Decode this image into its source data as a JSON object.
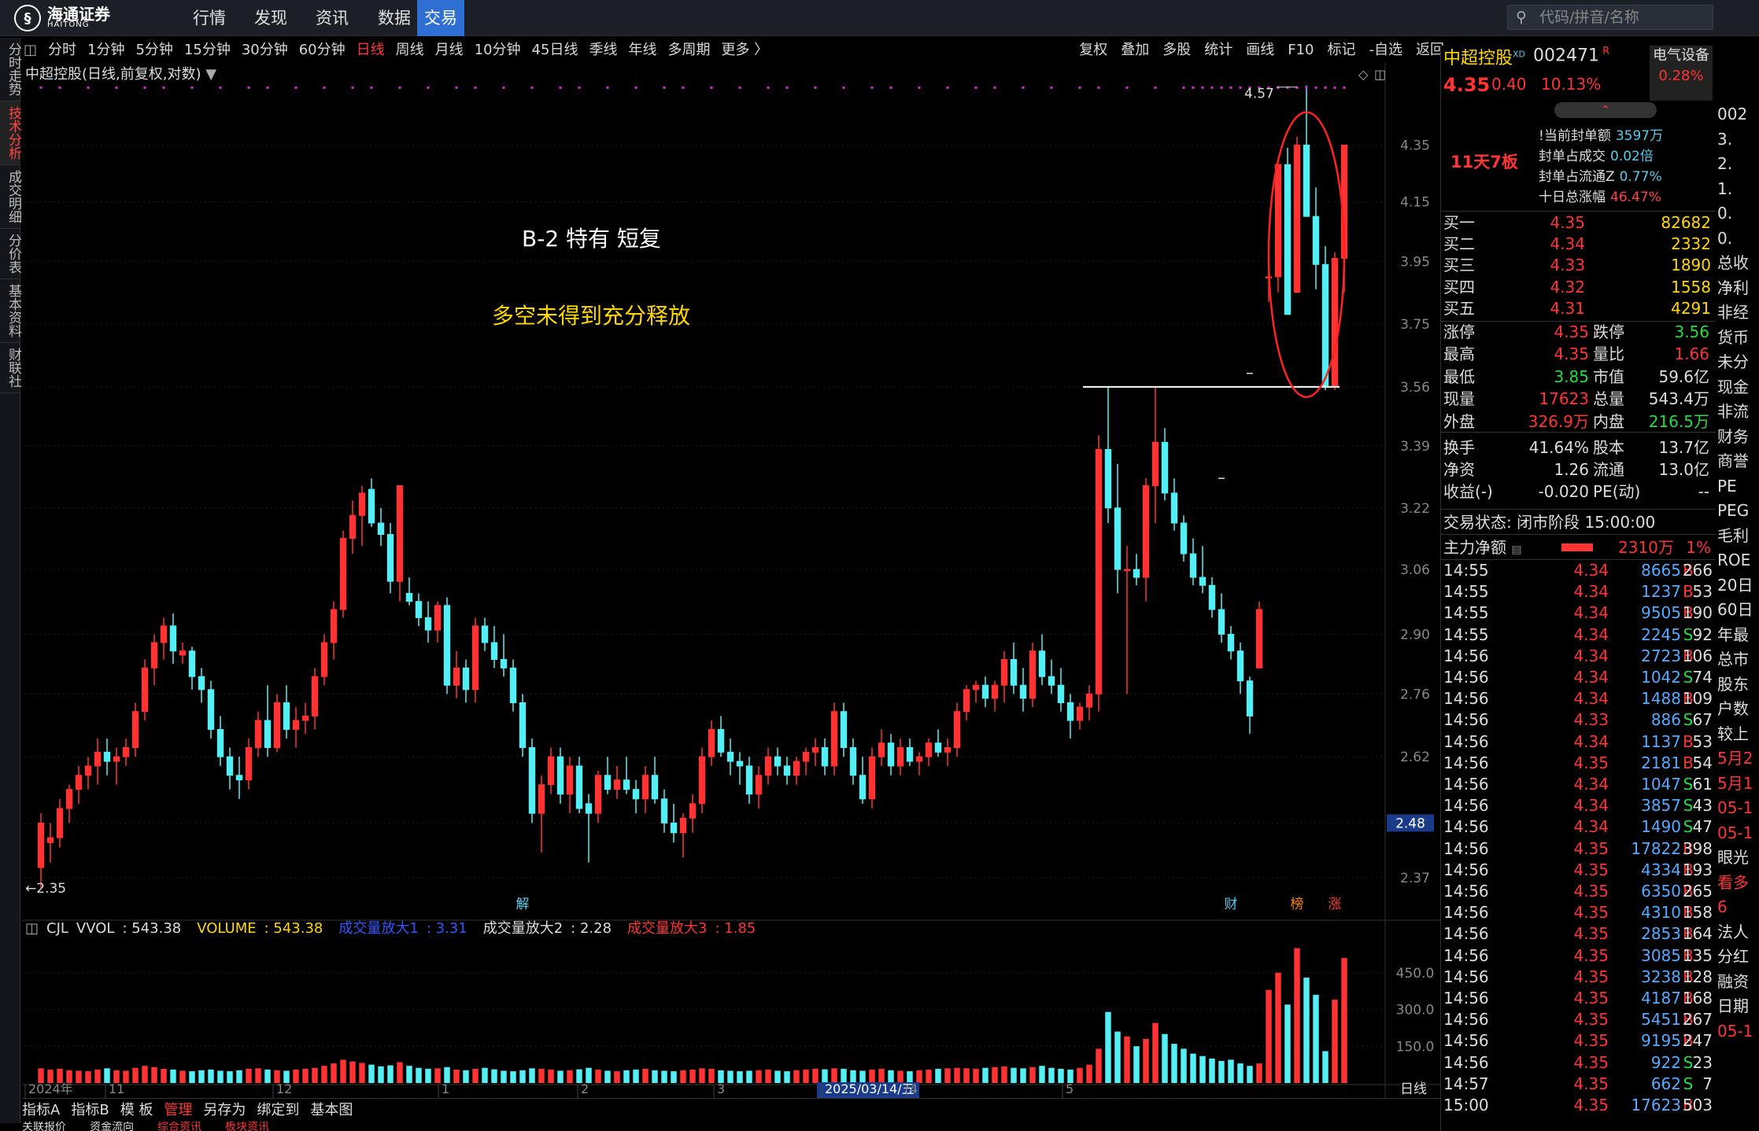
{
  "app": {
    "logo_text": "海通证券",
    "logo_sub": "HAITONG",
    "nav": [
      "行情",
      "发现",
      "资讯",
      "数据",
      "交易"
    ],
    "nav_active": "交易",
    "search_placeholder": "代码/拼音/名称"
  },
  "periods": [
    "分时",
    "1分钟",
    "5分钟",
    "15分钟",
    "30分钟",
    "60分钟",
    "日线",
    "周线",
    "月线",
    "10分钟",
    "45日线",
    "季线",
    "年线",
    "多周期",
    "更多 〉"
  ],
  "period_active": "日线",
  "tools_right": [
    "复权",
    "叠加",
    "多股",
    "统计",
    "画线",
    "F10",
    "标记",
    "-自选",
    "返回"
  ],
  "side_tabs": [
    "分时走势",
    "技术分析",
    "成交明细",
    "分价表",
    "基本资料",
    "财联社"
  ],
  "side_active": "技术分析",
  "chart_title": "中超控股(日线,前复权,对数)",
  "annotations": {
    "line1": "B-2 特有  短复",
    "line2": "多空未得到充分释放"
  },
  "chart_data": {
    "type": "candlestick",
    "price_axis": [
      4.35,
      4.15,
      3.95,
      3.75,
      3.56,
      3.39,
      3.22,
      3.06,
      2.9,
      2.76,
      2.62,
      2.48,
      2.37
    ],
    "price_range": [
      2.3,
      4.62
    ],
    "current_label": "2.48",
    "high_mark": "4.57",
    "low_mark": "←2.35",
    "event_marks": [
      "解",
      "财",
      "榜",
      "涨"
    ],
    "x_labels": [
      "2024年",
      "11",
      "12",
      "1",
      "2",
      "3",
      "2025/03/14/五",
      "4",
      "5"
    ],
    "period_label": "日线",
    "ohlc": [
      [
        2.39,
        2.5,
        2.35,
        2.48
      ],
      [
        2.44,
        2.48,
        2.4,
        2.45
      ],
      [
        2.45,
        2.53,
        2.43,
        2.51
      ],
      [
        2.51,
        2.56,
        2.48,
        2.55
      ],
      [
        2.55,
        2.6,
        2.52,
        2.58
      ],
      [
        2.58,
        2.62,
        2.55,
        2.6
      ],
      [
        2.6,
        2.66,
        2.56,
        2.63
      ],
      [
        2.63,
        2.66,
        2.58,
        2.61
      ],
      [
        2.61,
        2.64,
        2.56,
        2.62
      ],
      [
        2.62,
        2.66,
        2.6,
        2.64
      ],
      [
        2.64,
        2.74,
        2.62,
        2.72
      ],
      [
        2.72,
        2.84,
        2.7,
        2.82
      ],
      [
        2.82,
        2.9,
        2.78,
        2.88
      ],
      [
        2.88,
        2.94,
        2.84,
        2.92
      ],
      [
        2.92,
        2.95,
        2.83,
        2.86
      ],
      [
        2.85,
        2.88,
        2.83,
        2.86
      ],
      [
        2.86,
        2.87,
        2.77,
        2.8
      ],
      [
        2.8,
        2.82,
        2.74,
        2.77
      ],
      [
        2.77,
        2.79,
        2.66,
        2.68
      ],
      [
        2.68,
        2.71,
        2.6,
        2.62
      ],
      [
        2.62,
        2.64,
        2.55,
        2.58
      ],
      [
        2.58,
        2.62,
        2.53,
        2.57
      ],
      [
        2.57,
        2.66,
        2.55,
        2.64
      ],
      [
        2.64,
        2.72,
        2.62,
        2.7
      ],
      [
        2.7,
        2.78,
        2.62,
        2.64
      ],
      [
        2.64,
        2.76,
        2.63,
        2.74
      ],
      [
        2.74,
        2.78,
        2.66,
        2.68
      ],
      [
        2.68,
        2.73,
        2.64,
        2.7
      ],
      [
        2.7,
        2.74,
        2.67,
        2.71
      ],
      [
        2.71,
        2.82,
        2.68,
        2.8
      ],
      [
        2.8,
        2.9,
        2.78,
        2.88
      ],
      [
        2.88,
        2.98,
        2.84,
        2.96
      ],
      [
        2.96,
        3.16,
        2.94,
        3.14
      ],
      [
        3.14,
        3.24,
        3.1,
        3.2
      ],
      [
        3.2,
        3.28,
        3.12,
        3.26
      ],
      [
        3.27,
        3.3,
        3.17,
        3.18
      ],
      [
        3.18,
        3.22,
        3.12,
        3.15
      ],
      [
        3.15,
        3.18,
        3.0,
        3.03
      ],
      [
        3.03,
        3.28,
        2.98,
        3.28
      ],
      [
        3.0,
        3.04,
        2.97,
        2.98
      ],
      [
        2.98,
        3.0,
        2.92,
        2.94
      ],
      [
        2.94,
        2.98,
        2.88,
        2.91
      ],
      [
        2.91,
        2.98,
        2.88,
        2.97
      ],
      [
        2.97,
        2.99,
        2.76,
        2.78
      ],
      [
        2.78,
        2.86,
        2.75,
        2.82
      ],
      [
        2.82,
        2.84,
        2.74,
        2.77
      ],
      [
        2.77,
        2.94,
        2.74,
        2.92
      ],
      [
        2.92,
        2.94,
        2.86,
        2.88
      ],
      [
        2.88,
        2.92,
        2.82,
        2.84
      ],
      [
        2.84,
        2.9,
        2.8,
        2.82
      ],
      [
        2.82,
        2.84,
        2.72,
        2.74
      ],
      [
        2.74,
        2.76,
        2.62,
        2.64
      ],
      [
        2.64,
        2.66,
        2.48,
        2.5
      ],
      [
        2.5,
        2.58,
        2.42,
        2.56
      ],
      [
        2.56,
        2.64,
        2.54,
        2.62
      ],
      [
        2.62,
        2.64,
        2.52,
        2.54
      ],
      [
        2.54,
        2.62,
        2.5,
        2.6
      ],
      [
        2.6,
        2.62,
        2.5,
        2.51
      ],
      [
        2.52,
        2.54,
        2.4,
        2.5
      ],
      [
        2.5,
        2.59,
        2.48,
        2.58
      ],
      [
        2.58,
        2.62,
        2.54,
        2.55
      ],
      [
        2.55,
        2.6,
        2.53,
        2.57
      ],
      [
        2.57,
        2.62,
        2.54,
        2.55
      ],
      [
        2.55,
        2.57,
        2.5,
        2.53
      ],
      [
        2.53,
        2.6,
        2.5,
        2.58
      ],
      [
        2.58,
        2.62,
        2.52,
        2.53
      ],
      [
        2.53,
        2.55,
        2.46,
        2.48
      ],
      [
        2.48,
        2.52,
        2.44,
        2.46
      ],
      [
        2.46,
        2.5,
        2.41,
        2.49
      ],
      [
        2.49,
        2.54,
        2.46,
        2.52
      ],
      [
        2.52,
        2.64,
        2.5,
        2.62
      ],
      [
        2.62,
        2.7,
        2.6,
        2.68
      ],
      [
        2.68,
        2.71,
        2.62,
        2.63
      ],
      [
        2.63,
        2.66,
        2.58,
        2.61
      ],
      [
        2.61,
        2.63,
        2.56,
        2.6
      ],
      [
        2.6,
        2.62,
        2.52,
        2.54
      ],
      [
        2.54,
        2.6,
        2.51,
        2.58
      ],
      [
        2.58,
        2.64,
        2.56,
        2.62
      ],
      [
        2.62,
        2.64,
        2.58,
        2.6
      ],
      [
        2.6,
        2.62,
        2.56,
        2.58
      ],
      [
        2.58,
        2.62,
        2.56,
        2.61
      ],
      [
        2.61,
        2.64,
        2.58,
        2.63
      ],
      [
        2.63,
        2.66,
        2.6,
        2.64
      ],
      [
        2.64,
        2.66,
        2.58,
        2.6
      ],
      [
        2.6,
        2.74,
        2.58,
        2.72
      ],
      [
        2.72,
        2.74,
        2.62,
        2.64
      ],
      [
        2.64,
        2.66,
        2.56,
        2.58
      ],
      [
        2.58,
        2.62,
        2.52,
        2.53
      ],
      [
        2.53,
        2.64,
        2.51,
        2.62
      ],
      [
        2.62,
        2.68,
        2.6,
        2.65
      ],
      [
        2.65,
        2.67,
        2.58,
        2.6
      ],
      [
        2.6,
        2.66,
        2.58,
        2.64
      ],
      [
        2.64,
        2.66,
        2.6,
        2.61
      ],
      [
        2.61,
        2.63,
        2.58,
        2.62
      ],
      [
        2.62,
        2.66,
        2.6,
        2.65
      ],
      [
        2.65,
        2.68,
        2.62,
        2.63
      ],
      [
        2.63,
        2.66,
        2.6,
        2.64
      ],
      [
        2.64,
        2.74,
        2.62,
        2.72
      ],
      [
        2.72,
        2.78,
        2.7,
        2.77
      ],
      [
        2.77,
        2.79,
        2.74,
        2.78
      ],
      [
        2.78,
        2.8,
        2.73,
        2.75
      ],
      [
        2.75,
        2.79,
        2.72,
        2.78
      ],
      [
        2.78,
        2.86,
        2.74,
        2.84
      ],
      [
        2.84,
        2.88,
        2.76,
        2.78
      ],
      [
        2.78,
        2.82,
        2.72,
        2.75
      ],
      [
        2.75,
        2.88,
        2.73,
        2.86
      ],
      [
        2.86,
        2.9,
        2.78,
        2.8
      ],
      [
        2.8,
        2.84,
        2.76,
        2.78
      ],
      [
        2.78,
        2.82,
        2.72,
        2.74
      ],
      [
        2.74,
        2.76,
        2.66,
        2.7
      ],
      [
        2.7,
        2.74,
        2.68,
        2.73
      ],
      [
        2.73,
        2.78,
        2.7,
        2.76
      ],
      [
        2.76,
        3.42,
        2.72,
        3.38
      ],
      [
        3.38,
        3.56,
        3.18,
        3.22
      ],
      [
        3.22,
        3.34,
        3.0,
        3.06
      ],
      [
        3.06,
        3.12,
        2.76,
        3.06
      ],
      [
        3.06,
        3.1,
        3.02,
        3.04
      ],
      [
        3.04,
        3.3,
        2.98,
        3.28
      ],
      [
        3.28,
        3.56,
        3.18,
        3.4
      ],
      [
        3.4,
        3.44,
        3.24,
        3.26
      ],
      [
        3.26,
        3.3,
        3.16,
        3.18
      ],
      [
        3.18,
        3.2,
        3.08,
        3.1
      ],
      [
        3.1,
        3.14,
        3.02,
        3.04
      ],
      [
        3.04,
        3.12,
        3.0,
        3.02
      ],
      [
        3.02,
        3.04,
        2.94,
        2.96
      ],
      [
        2.96,
        3.0,
        2.88,
        2.9
      ],
      [
        2.9,
        2.92,
        2.84,
        2.86
      ],
      [
        2.86,
        2.88,
        2.76,
        2.79
      ],
      [
        2.79,
        2.8,
        2.67,
        2.71
      ],
      [
        2.82,
        2.98,
        2.82,
        2.96
      ],
      [
        3.9,
        3.94,
        3.82,
        3.9
      ],
      [
        3.9,
        4.28,
        3.85,
        4.28
      ],
      [
        4.28,
        4.34,
        3.78,
        3.78
      ],
      [
        3.85,
        4.38,
        3.85,
        4.35
      ],
      [
        4.35,
        4.57,
        4.1,
        4.1
      ],
      [
        4.1,
        4.2,
        3.86,
        3.94
      ],
      [
        3.94,
        4.0,
        3.55,
        3.56
      ],
      [
        3.56,
        3.98,
        3.55,
        3.96
      ],
      [
        3.96,
        4.35,
        3.85,
        4.35
      ]
    ],
    "volume": [
      60,
      55,
      58,
      52,
      50,
      48,
      55,
      60,
      52,
      50,
      62,
      70,
      65,
      58,
      55,
      50,
      48,
      52,
      55,
      50,
      48,
      52,
      58,
      60,
      55,
      52,
      50,
      55,
      58,
      62,
      70,
      80,
      95,
      88,
      82,
      75,
      68,
      72,
      85,
      70,
      62,
      58,
      60,
      65,
      55,
      52,
      58,
      62,
      56,
      50,
      48,
      52,
      60,
      58,
      55,
      50,
      52,
      56,
      62,
      55,
      50,
      48,
      52,
      55,
      58,
      52,
      50,
      48,
      52,
      55,
      60,
      58,
      52,
      50,
      48,
      50,
      52,
      55,
      50,
      48,
      52,
      55,
      58,
      56,
      60,
      58,
      52,
      50,
      55,
      58,
      52,
      50,
      48,
      52,
      55,
      58,
      60,
      62,
      60,
      58,
      62,
      65,
      68,
      62,
      60,
      65,
      70,
      62,
      58,
      55,
      62,
      75,
      140,
      290,
      210,
      190,
      150,
      180,
      245,
      200,
      160,
      140,
      120,
      110,
      100,
      90,
      95,
      80,
      70,
      80,
      380,
      450,
      320,
      550,
      430,
      360,
      130,
      340,
      510
    ],
    "vol_axis": [
      450.0,
      300.0,
      150.0
    ],
    "vol_range": [
      0,
      600
    ],
    "indicator_name": "CJL",
    "indicator_values": [
      {
        "name": "VVOL",
        "value": "543.38",
        "color": "#dddddd"
      },
      {
        "name": "VOLUME",
        "value": "543.38",
        "color": "#ffd700"
      },
      {
        "name": "成交量放大1",
        "value": "3.31",
        "color": "#3355ff"
      },
      {
        "name": "成交量放大2",
        "value": "2.28",
        "color": "#dddddd"
      },
      {
        "name": "成交量放大3",
        "value": "1.85",
        "color": "#ff3333"
      }
    ]
  },
  "quote": {
    "name": "中超控股",
    "tag": "XD",
    "code": "002471",
    "r_flag": "R",
    "price": "4.35",
    "change": "0.40",
    "pct": "10.13%",
    "sector": "电气设备",
    "sector_pct": "0.28%",
    "seal_label": "11天7板",
    "seal": [
      {
        "k": "!当前封单额",
        "v": "3597万"
      },
      {
        "k": "封单占成交",
        "v": "0.02倍"
      },
      {
        "k": "封单占流通Z",
        "v": "0.77%"
      },
      {
        "k": "十日总涨幅",
        "v": "46.47%"
      }
    ],
    "bids": [
      {
        "l": "买一",
        "p": "4.35",
        "v": "82682"
      },
      {
        "l": "买二",
        "p": "4.34",
        "v": "2332"
      },
      {
        "l": "买三",
        "p": "4.33",
        "v": "1890"
      },
      {
        "l": "买四",
        "p": "4.32",
        "v": "1558"
      },
      {
        "l": "买五",
        "p": "4.31",
        "v": "4291"
      }
    ],
    "stats": [
      {
        "l1": "涨停",
        "v1": "4.35",
        "c1": "red",
        "l2": "跌停",
        "v2": "3.56",
        "c2": "green"
      },
      {
        "l1": "最高",
        "v1": "4.35",
        "c1": "red",
        "l2": "量比",
        "v2": "1.66",
        "c2": "red"
      },
      {
        "l1": "最低",
        "v1": "3.85",
        "c1": "green",
        "l2": "市值",
        "v2": "59.6亿",
        "c2": "white"
      },
      {
        "l1": "现量",
        "v1": "17623",
        "c1": "red",
        "l2": "总量",
        "v2": "543.4万",
        "c2": "white"
      },
      {
        "l1": "外盘",
        "v1": "326.9万",
        "c1": "red",
        "l2": "内盘",
        "v2": "216.5万",
        "c2": "green"
      },
      {
        "l1": "换手",
        "v1": "41.64%",
        "c1": "white",
        "l2": "股本",
        "v2": "13.7亿",
        "c2": "white"
      },
      {
        "l1": "净资",
        "v1": "1.26",
        "c1": "white",
        "l2": "流通",
        "v2": "13.0亿",
        "c2": "white"
      },
      {
        "l1": "收益(-)",
        "v1": "-0.020",
        "c1": "white",
        "l2": "PE(动)",
        "v2": "--",
        "c2": "white"
      }
    ],
    "trade_status": "交易状态: 闭市阶段 15:00:00",
    "main_flow_label": "主力净额",
    "main_flow_value": "2310万",
    "main_flow_pct": "1%"
  },
  "ticks": [
    {
      "t": "14:55",
      "p": "4.34",
      "v": "8665",
      "bs": "B",
      "n": "266"
    },
    {
      "t": "14:55",
      "p": "4.34",
      "v": "1237",
      "bs": "B",
      "n": "53"
    },
    {
      "t": "14:55",
      "p": "4.34",
      "v": "9505",
      "bs": "B",
      "n": "190"
    },
    {
      "t": "14:55",
      "p": "4.34",
      "v": "2245",
      "bs": "S",
      "n": "92"
    },
    {
      "t": "14:56",
      "p": "4.34",
      "v": "2723",
      "bs": "B",
      "n": "106"
    },
    {
      "t": "14:56",
      "p": "4.34",
      "v": "1042",
      "bs": "S",
      "n": "74"
    },
    {
      "t": "14:56",
      "p": "4.34",
      "v": "1488",
      "bs": "B",
      "n": "109"
    },
    {
      "t": "14:56",
      "p": "4.33",
      "v": "886",
      "bs": "S",
      "n": "67"
    },
    {
      "t": "14:56",
      "p": "4.34",
      "v": "1137",
      "bs": "B",
      "n": "53"
    },
    {
      "t": "14:56",
      "p": "4.35",
      "v": "2181",
      "bs": "B",
      "n": "54"
    },
    {
      "t": "14:56",
      "p": "4.34",
      "v": "1047",
      "bs": "S",
      "n": "61"
    },
    {
      "t": "14:56",
      "p": "4.34",
      "v": "3857",
      "bs": "S",
      "n": "43"
    },
    {
      "t": "14:56",
      "p": "4.34",
      "v": "1490",
      "bs": "S",
      "n": "47"
    },
    {
      "t": "14:56",
      "p": "4.35",
      "v": "17822",
      "bs": "B",
      "n": "398"
    },
    {
      "t": "14:56",
      "p": "4.35",
      "v": "4334",
      "bs": "B",
      "n": "193"
    },
    {
      "t": "14:56",
      "p": "4.35",
      "v": "6350",
      "bs": "B",
      "n": "265"
    },
    {
      "t": "14:56",
      "p": "4.35",
      "v": "4310",
      "bs": "B",
      "n": "158"
    },
    {
      "t": "14:56",
      "p": "4.35",
      "v": "2853",
      "bs": "B",
      "n": "164"
    },
    {
      "t": "14:56",
      "p": "4.35",
      "v": "3085",
      "bs": "B",
      "n": "135"
    },
    {
      "t": "14:56",
      "p": "4.35",
      "v": "3238",
      "bs": "B",
      "n": "128"
    },
    {
      "t": "14:56",
      "p": "4.35",
      "v": "4187",
      "bs": "B",
      "n": "168"
    },
    {
      "t": "14:56",
      "p": "4.35",
      "v": "5451",
      "bs": "B",
      "n": "267"
    },
    {
      "t": "14:56",
      "p": "4.35",
      "v": "9195",
      "bs": "B",
      "n": "247"
    },
    {
      "t": "14:56",
      "p": "4.35",
      "v": "922",
      "bs": "S",
      "n": "23"
    },
    {
      "t": "14:57",
      "p": "4.35",
      "v": "662",
      "bs": "S",
      "n": "7"
    },
    {
      "t": "15:00",
      "p": "4.35",
      "v": "17623",
      "bs": "B",
      "n": "503"
    }
  ],
  "far_right": [
    "002",
    "3.",
    "2.",
    "1.",
    "0.",
    "0.",
    "总收",
    "净利",
    "非经",
    "货币",
    "未分",
    "现金",
    "非流",
    "财务",
    "商誉",
    "PE",
    "PEG",
    "毛利",
    "ROE",
    "20日",
    "60日",
    "年最",
    "总市",
    "股东",
    "户数",
    "较上",
    "5月2",
    "5月1",
    "05-1",
    "05-1",
    "眼光",
    "看多",
    "6",
    "法人",
    "分红",
    "融资",
    "日期",
    "05-1"
  ],
  "bottom_tabs": [
    "指标A",
    "指标B",
    "模 板",
    "管理",
    "另存为",
    "绑定到",
    "基本图"
  ],
  "bottom_active": "管理",
  "bottom_tabs2": [
    "关联报价",
    "资金流向",
    "综合资讯",
    "板块资讯"
  ]
}
